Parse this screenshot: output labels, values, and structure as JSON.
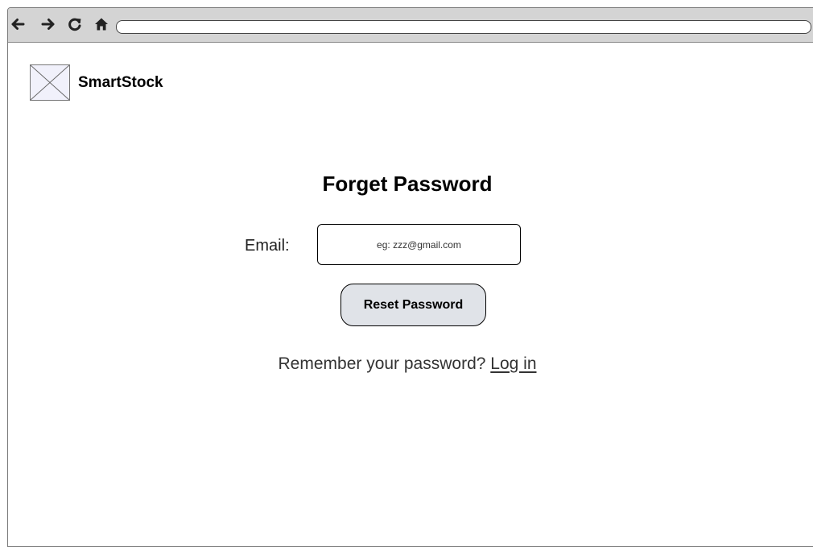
{
  "browser": {
    "icons": [
      "back-arrow-icon",
      "forward-arrow-icon",
      "reload-icon",
      "home-icon"
    ],
    "url": ""
  },
  "header": {
    "logo_icon": "image-placeholder-icon",
    "brand_name": "SmartStock"
  },
  "form": {
    "title": "Forget Password",
    "email_label": "Email:",
    "email_value": "",
    "email_placeholder": "eg: zzz@gmail.com",
    "submit_label": "Reset Password",
    "remember_text": "Remember your password?",
    "login_link": "Log in"
  },
  "colors": {
    "browser_bar": "#d4d4d4",
    "button_bg": "#e0e3e8",
    "logo_bg": "#f1f1fb"
  }
}
